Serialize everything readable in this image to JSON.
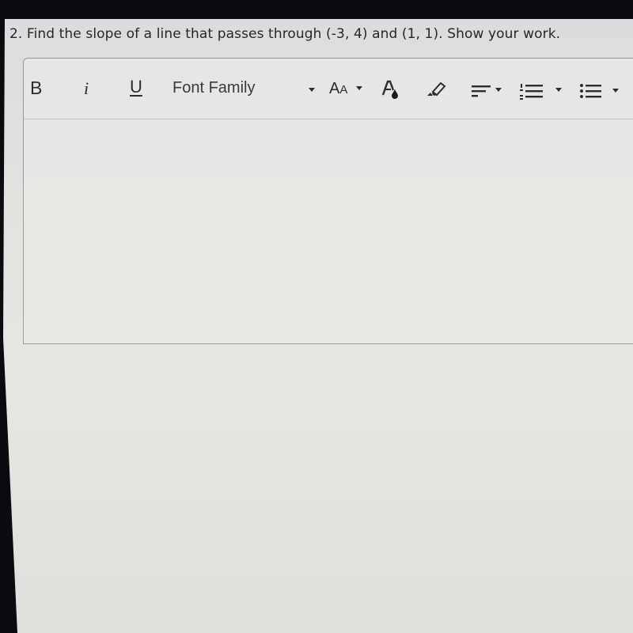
{
  "question": {
    "text": "2. Find the slope of a line that passes through (-3, 4) and (1, 1). Show your work."
  },
  "editor": {
    "toolbar": {
      "bold_label": "B",
      "italic_label": "i",
      "underline_label": "U",
      "font_family_label": "Font Family",
      "font_size_label_large": "A",
      "font_size_label_small": "A",
      "icons": [
        "bold",
        "italic",
        "underline",
        "font-family-dropdown",
        "font-size-dropdown",
        "text-color",
        "highlight",
        "align-dropdown",
        "ordered-list-dropdown",
        "bullet-list-dropdown"
      ]
    },
    "content": ""
  }
}
